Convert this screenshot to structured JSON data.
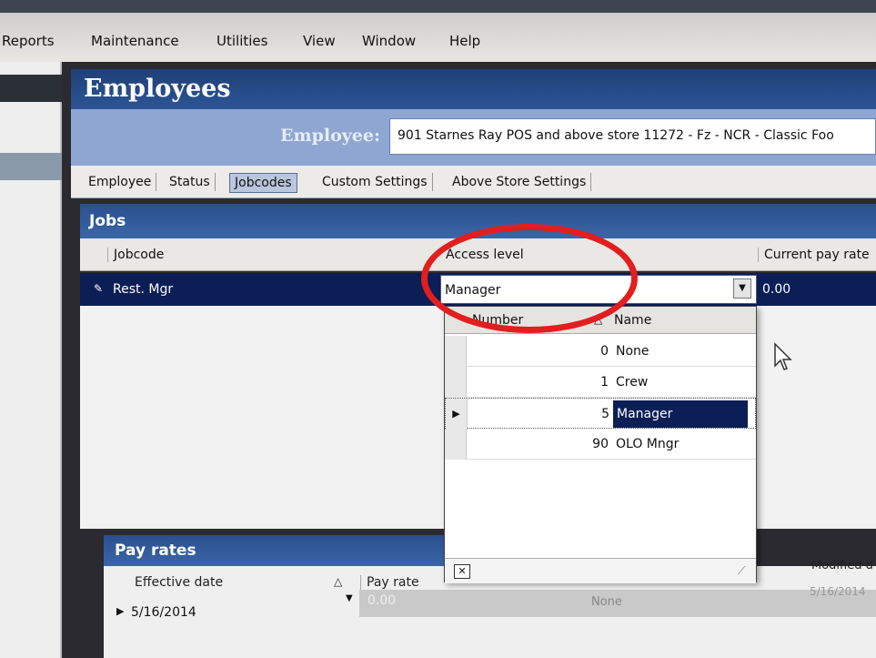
{
  "menu": [
    "Reports",
    "Maintenance",
    "Utilities",
    "View",
    "Window",
    "Help"
  ],
  "window": {
    "title": "Employees"
  },
  "employee": {
    "label": "Employee:",
    "value": "901 Starnes Ray POS and above store 11272 - Fz - NCR - Classic Foo"
  },
  "tabs": [
    "Employee",
    "Status",
    "Jobcodes",
    "Custom Settings",
    "Above Store Settings"
  ],
  "jobs": {
    "title": "Jobs",
    "columns": [
      "Jobcode",
      "Access level",
      "Current pay rate"
    ],
    "rows": [
      {
        "jobcode": "Rest. Mgr",
        "access_level": "Manager",
        "pay_rate": "0.00"
      }
    ]
  },
  "access_dropdown": {
    "columns": [
      "Number",
      "Name"
    ],
    "options": [
      {
        "number": "0",
        "name": "None"
      },
      {
        "number": "1",
        "name": "Crew"
      },
      {
        "number": "5",
        "name": "Manager"
      },
      {
        "number": "90",
        "name": "OLO Mngr"
      }
    ],
    "selected_index": 2,
    "close_label": "✕"
  },
  "pay_rates": {
    "title": "Pay rates",
    "columns": [
      "Effective date",
      "Pay rate",
      "Modified d"
    ],
    "rows": [
      {
        "effective_date": "5/16/2014",
        "pay_rate": "0.00",
        "access": "None",
        "modified": "5/16/2014"
      }
    ]
  },
  "colors": {
    "title_bar": "#1f3f76",
    "selected_row": "#0b1e56",
    "annotation_ring": "#e21e1e"
  }
}
